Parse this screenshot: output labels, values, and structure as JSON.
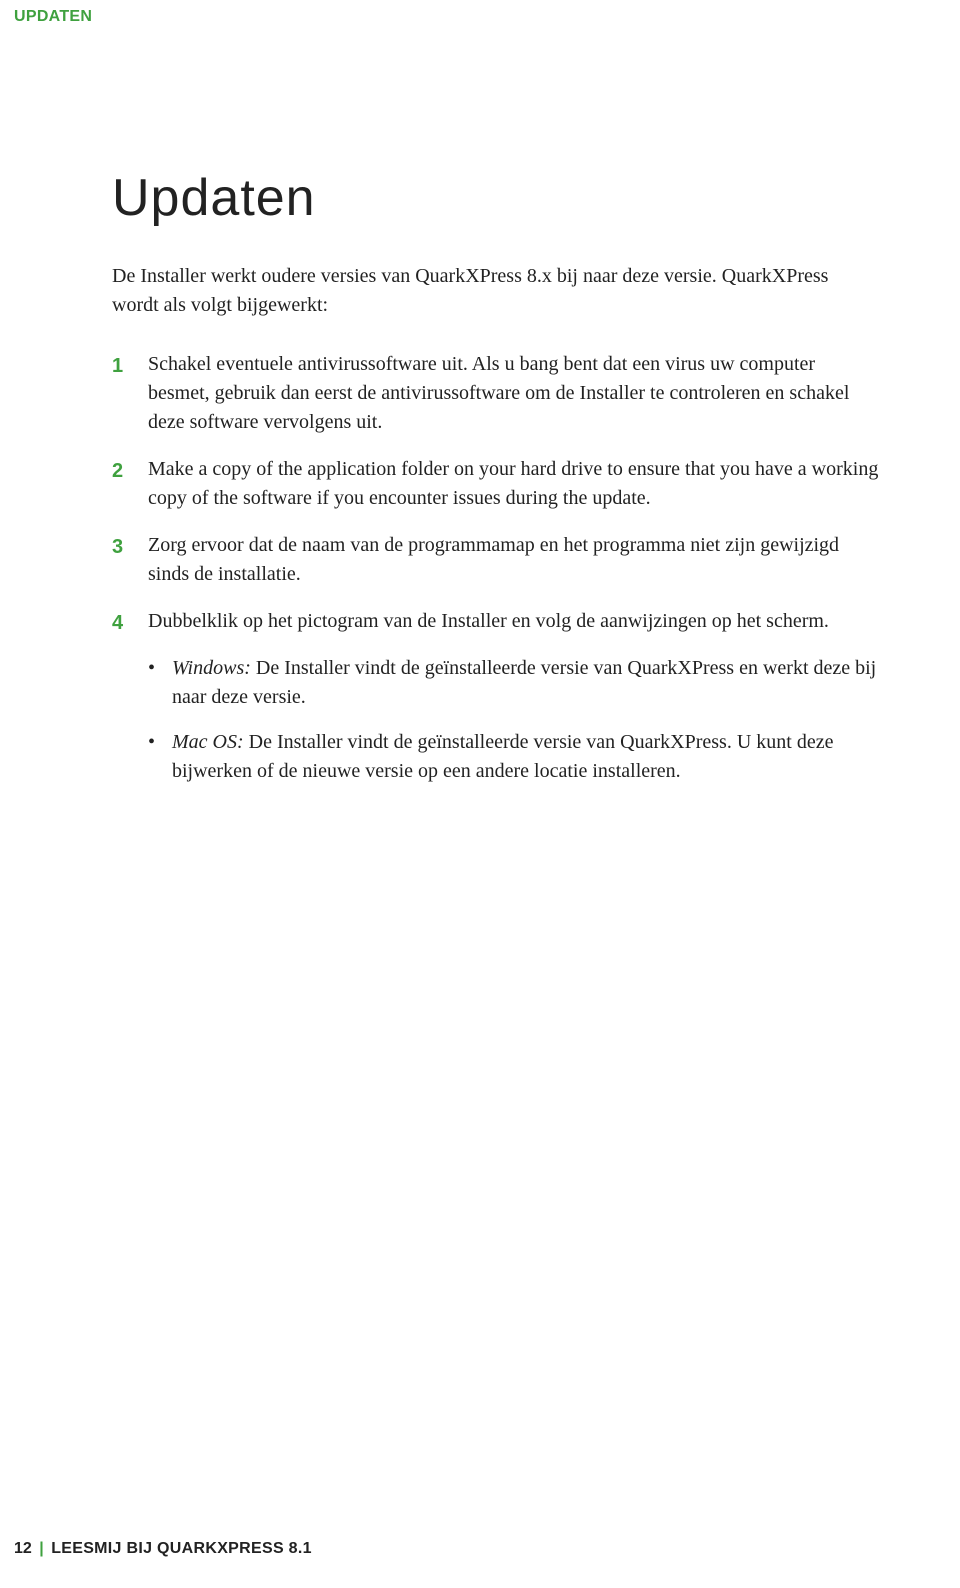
{
  "header": {
    "label": "UPDATEN"
  },
  "title": "Updaten",
  "intro": "De Installer werkt oudere versies van QuarkXPress 8.x bij naar deze versie. QuarkXPress wordt als volgt bijgewerkt:",
  "steps": [
    "Schakel eventuele antivirussoftware uit. Als u bang bent dat een virus uw computer besmet, gebruik dan eerst de antivirussoftware om de Installer te controleren en schakel deze software vervolgens uit.",
    "Make a copy of the application folder on your hard drive to ensure that you have a working copy of the software if you encounter issues during the update.",
    "Zorg ervoor dat de naam van de programmamap en het programma niet zijn gewijzigd sinds de installatie.",
    "Dubbelklik op het pictogram van de Installer en volg de aanwijzingen op het scherm."
  ],
  "bullets": [
    {
      "lead": "Windows:",
      "text": " De Installer vindt de geïnstalleerde versie van QuarkXPress en werkt deze bij naar deze versie."
    },
    {
      "lead": "Mac OS:",
      "text": " De Installer vindt de geïnstalleerde versie van QuarkXPress. U kunt deze bijwerken of de nieuwe versie op een andere locatie installeren."
    }
  ],
  "footer": {
    "page": "12",
    "pipe": "|",
    "doc": "LEESMIJ BIJ QUARKXPRESS 8.1"
  }
}
